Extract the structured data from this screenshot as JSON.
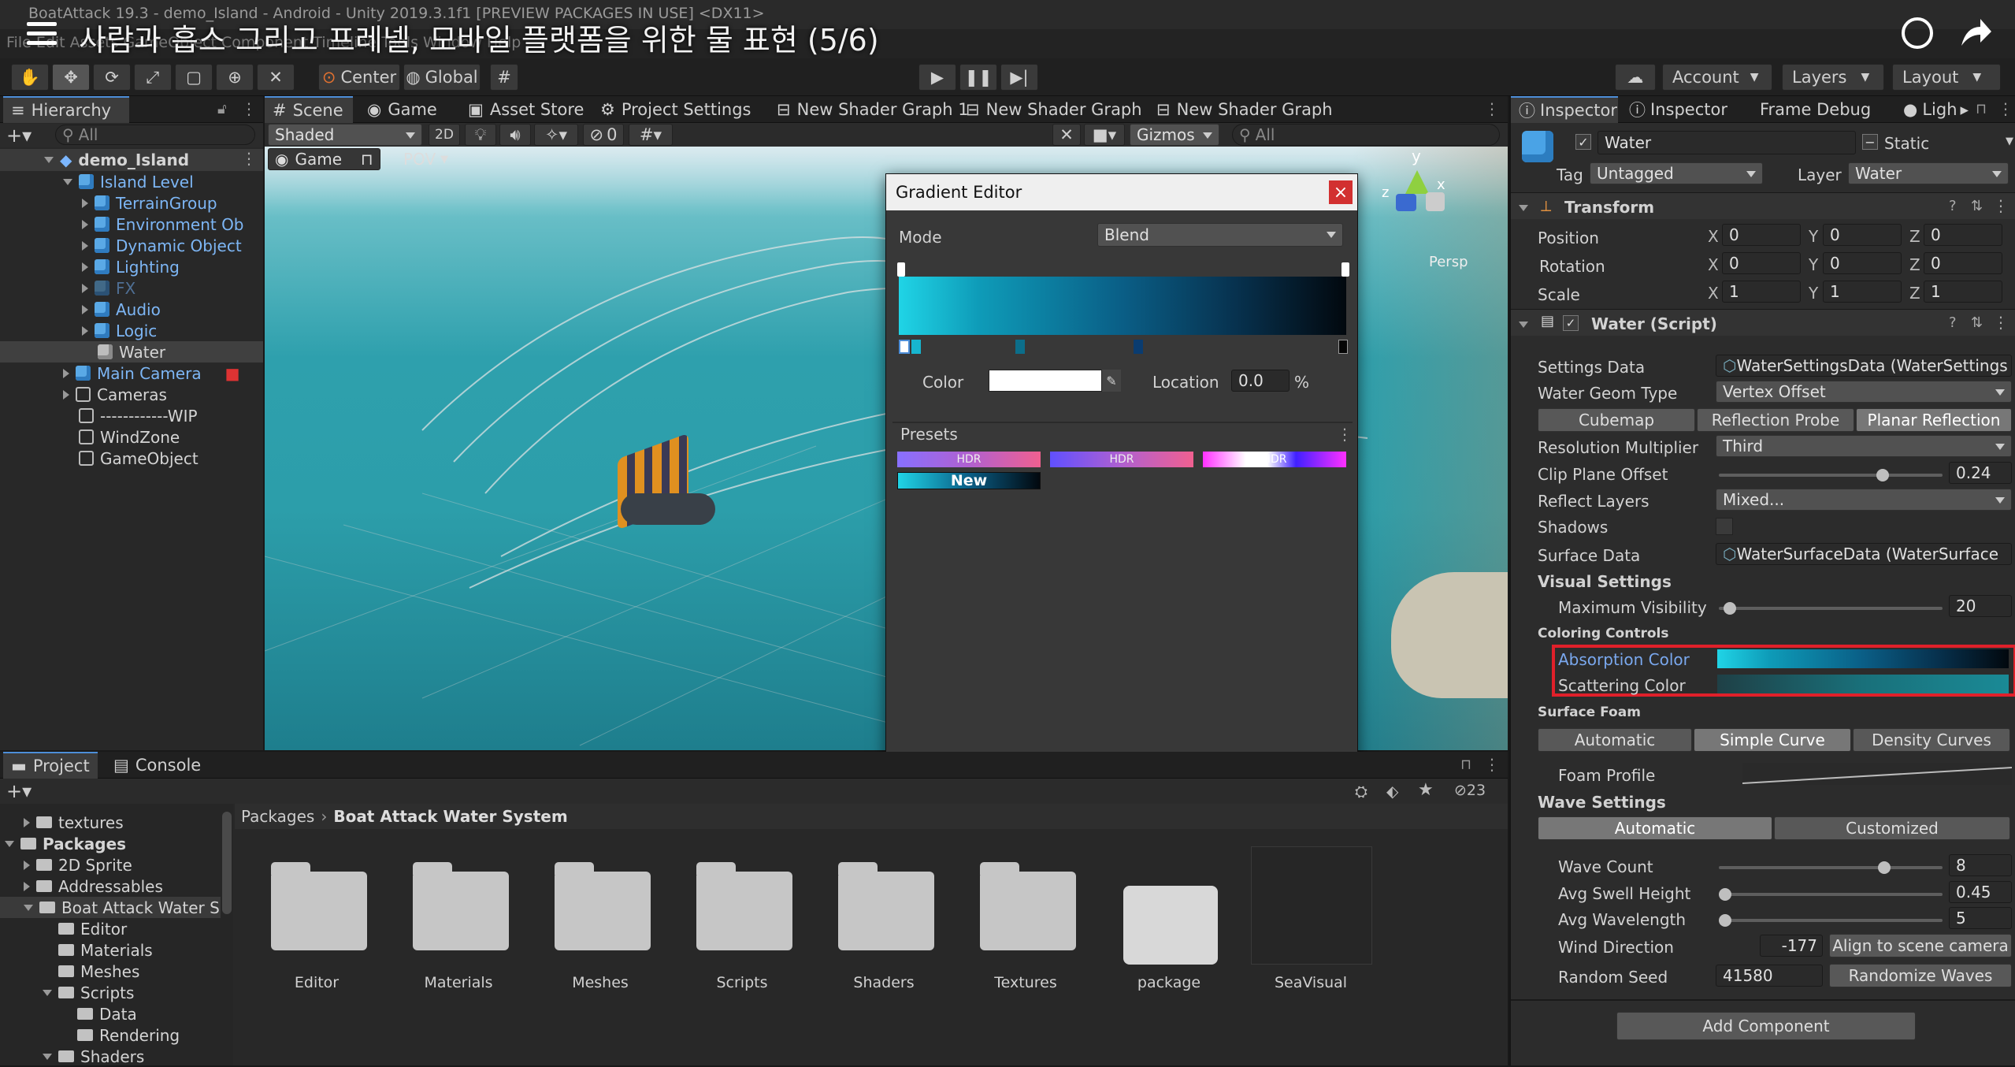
{
  "window": {
    "title": "BoatAttack 19.3 - demo_Island - Android - Unity 2019.3.1f1 [PREVIEW PACKAGES IN USE] <DX11>",
    "menubar": "File  Edit  Assets  GameObject  Component  Timeline  Tools  Window  Help",
    "video_title": "사람과 흡스 그리고 프레넬, 모바일 플랫폼을 위한 물 표현 (5/6)"
  },
  "toolbar": {
    "pivot": "Center",
    "space": "Global",
    "account": "Account",
    "layers": "Layers",
    "layout": "Layout"
  },
  "tabs": {
    "hierarchy": "Hierarchy",
    "scene": "Scene",
    "game": "Game",
    "asset_store": "Asset Store",
    "project_settings": "Project Settings",
    "shader1": "New Shader Graph 1",
    "shader2": "New Shader Graph",
    "shader3": "New Shader Graph",
    "inspector1": "Inspector",
    "inspector2": "Inspector",
    "frame_debug": "Frame Debug",
    "lighting": "Ligh",
    "project": "Project",
    "console": "Console"
  },
  "scene_bar": {
    "shading": "Shaded",
    "mode2d": "2D",
    "hidden_count": "0",
    "gizmos": "Gizmos",
    "search_placeholder": "All",
    "game_label": "Game",
    "pov": "POV",
    "axis_y": "y",
    "axis_x": "x",
    "axis_z": "z",
    "persp": "Persp"
  },
  "hierarchy": {
    "search_placeholder": "All",
    "scene": "demo_Island",
    "items": [
      "Island Level",
      "TerrainGroup",
      "Environment Ob",
      "Dynamic Object",
      "Lighting",
      "FX",
      "Audio",
      "Logic",
      "Water",
      "Main Camera",
      "Cameras",
      "------------WIP",
      "WindZone",
      "GameObject"
    ]
  },
  "gradient_editor": {
    "title": "Gradient Editor",
    "mode_label": "Mode",
    "mode_value": "Blend",
    "color_label": "Color",
    "location_label": "Location",
    "location_value": "0.0",
    "location_unit": "%",
    "presets_label": "Presets",
    "preset_hdr": "HDR",
    "preset_new": "New"
  },
  "project": {
    "tree": [
      "textures",
      "Packages",
      "2D Sprite",
      "Addressables",
      "Boat Attack Water S",
      "Editor",
      "Materials",
      "Meshes",
      "Scripts",
      "Data",
      "Rendering",
      "Shaders"
    ],
    "breadcrumb_root": "Packages",
    "breadcrumb_leaf": "Boat Attack Water System",
    "hidden_count": "23",
    "folders": [
      "Editor",
      "Materials",
      "Meshes",
      "Scripts",
      "Shaders",
      "Textures",
      "package",
      "SeaVisual"
    ]
  },
  "inspector": {
    "object_name": "Water",
    "static_label": "Static",
    "tag_label": "Tag",
    "tag_value": "Untagged",
    "layer_label": "Layer",
    "layer_value": "Water",
    "transform_title": "Transform",
    "position": {
      "label": "Position",
      "x": "0",
      "y": "0",
      "z": "0"
    },
    "rotation": {
      "label": "Rotation",
      "x": "0",
      "y": "0",
      "z": "0"
    },
    "scale": {
      "label": "Scale",
      "x": "1",
      "y": "1",
      "z": "1"
    },
    "axis": {
      "x": "X",
      "y": "Y",
      "z": "Z"
    },
    "script_title": "Water (Script)",
    "settings_data_label": "Settings Data",
    "settings_data_value": "WaterSettingsData (WaterSettings",
    "geom_type_label": "Water Geom Type",
    "geom_type_value": "Vertex Offset",
    "reflection_buttons": [
      "Cubemap",
      "Reflection Probe",
      "Planar Reflection"
    ],
    "resolution_label": "Resolution Multiplier",
    "resolution_value": "Third",
    "clip_label": "Clip Plane Offset",
    "clip_value": "0.24",
    "reflect_layers_label": "Reflect Layers",
    "reflect_layers_value": "Mixed...",
    "shadows_label": "Shadows",
    "surface_data_label": "Surface Data",
    "surface_data_value": "WaterSurfaceData (WaterSurface",
    "visual_settings": "Visual Settings",
    "max_visibility_label": "Maximum Visibility",
    "max_visibility_value": "20",
    "coloring_controls": "Coloring Controls",
    "absorption_label": "Absorption Color",
    "scattering_label": "Scattering Color",
    "surface_foam": "Surface Foam",
    "foam_buttons": [
      "Automatic",
      "Simple Curve",
      "Density Curves"
    ],
    "foam_profile_label": "Foam Profile",
    "wave_settings": "Wave Settings",
    "wave_buttons": [
      "Automatic",
      "Customized"
    ],
    "wave_count_label": "Wave Count",
    "wave_count_value": "8",
    "swell_label": "Avg Swell Height",
    "swell_value": "0.45",
    "wavelength_label": "Avg Wavelength",
    "wavelength_value": "5",
    "wind_label": "Wind Direction",
    "wind_value": "-177",
    "align_button": "Align to scene camera",
    "seed_label": "Random Seed",
    "seed_value": "41580",
    "randomize_button": "Randomize Waves",
    "add_component": "Add Component"
  },
  "colors": {
    "accent_blue": "#4d8ed8",
    "highlight_red": "#e0202a",
    "water_teal": "#1ab3c6"
  }
}
